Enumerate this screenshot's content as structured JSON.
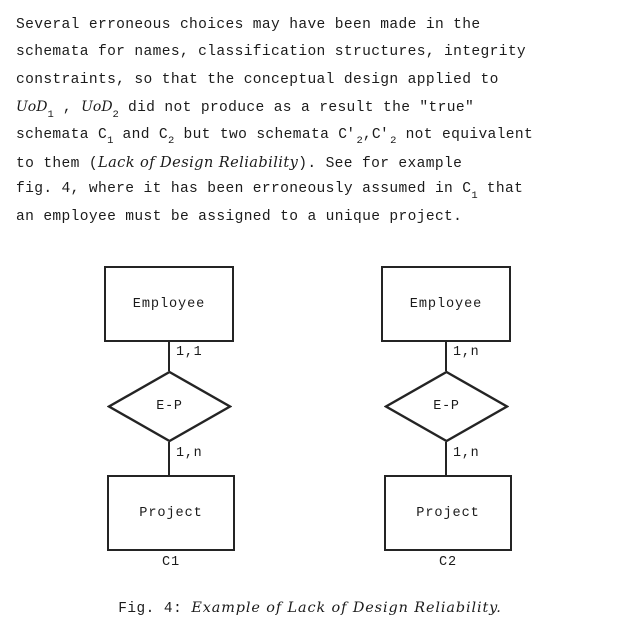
{
  "document": {
    "paragraph_lines": [
      "Several erroneous choices may have been made in the",
      "schemata for names, classification structures, integrity",
      "constraints, so that the conceptual design applied to",
      "UoD1 , UoD2 did not produce as a result the \"true\"",
      "schemata C1 and C2 but two schemata C'2,C'2 not equivalent",
      "to them  (Lack of Design Reliability). See for example",
      "fig. 4, where it has been erroneously assumed in C1 that",
      "an employee must be assigned to a unique project."
    ],
    "line4": {
      "uod_a": "UoD",
      "uod_a_sub": "1",
      "sep": " , ",
      "uod_b": "UoD",
      "uod_b_sub": "2",
      "rest": " did not produce as a result the \"true\""
    },
    "line5": {
      "pre": "schemata C",
      "c1_sub": "1",
      "mid": " and C",
      "c2_sub": "2",
      "mid2": " but two schemata C",
      "prime1": "'",
      "p1_sub": "2",
      "comma": ",C",
      "prime2": "'",
      "p2_sub": "2",
      "post": " not equivalent"
    },
    "line6": {
      "pre": "to them  (",
      "emphasis": "Lack of Design Reliability",
      "post": "). See for example"
    },
    "line7": {
      "pre": "fig. 4, where it has been erroneously assumed in C",
      "sub": "1",
      "post": " that"
    },
    "line8": "an employee must be assigned to a unique project."
  },
  "figure": {
    "diagrams": [
      {
        "id": "c1",
        "top_entity": "Employee",
        "relationship": "E-P",
        "bottom_entity": "Project",
        "top_cardinality": "1,1",
        "bottom_cardinality": "1,n",
        "schema_label": "C1"
      },
      {
        "id": "c2",
        "top_entity": "Employee",
        "relationship": "E-P",
        "bottom_entity": "Project",
        "top_cardinality": "1,n",
        "bottom_cardinality": "1,n",
        "schema_label": "C2"
      }
    ],
    "caption": {
      "number": "Fig. 4: ",
      "title": "Example of Lack of Design Reliability."
    }
  },
  "colors": {
    "ink": "#1b1b1b",
    "stroke": "#242424",
    "paper": "#ffffff"
  }
}
